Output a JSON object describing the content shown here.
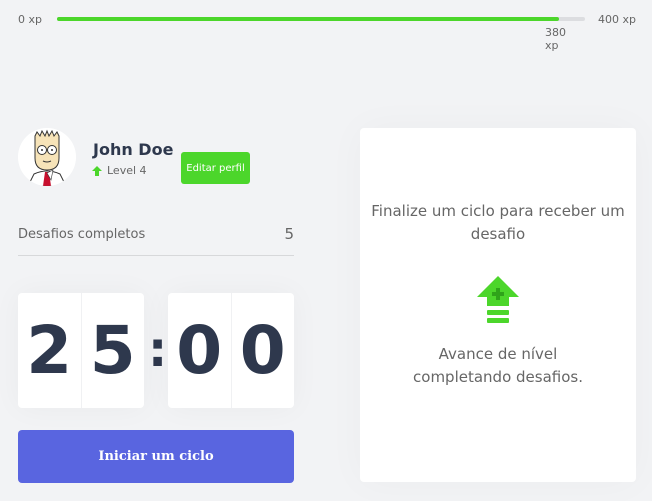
{
  "experience": {
    "min_label": "0 xp",
    "max_label": "400 xp",
    "current_label": "380 xp",
    "current_xp": 380,
    "max_xp": 400,
    "progress_fraction": 0.95,
    "bar_color": "#4cd62b"
  },
  "profile": {
    "name": "John Doe",
    "level_label": "Level 4",
    "level_icon": "level-up-arrow-icon",
    "edit_button_label": "Editar perfil",
    "avatar_icon": "avatar-cartoon"
  },
  "challenges": {
    "label": "Desafios completos",
    "count": "5"
  },
  "countdown": {
    "minutes": [
      "2",
      "5"
    ],
    "seconds": [
      "0",
      "0"
    ],
    "separator": ":"
  },
  "start_button": {
    "label": "Iniciar um ciclo",
    "color": "#5965e0"
  },
  "challenge_card": {
    "title": "Finalize um ciclo para receber um desafio",
    "icon": "level-up-icon",
    "text": "Avance de nível completando desafios."
  },
  "colors": {
    "background": "#f2f3f5",
    "text": "#666666",
    "title": "#2e384d",
    "green": "#4cd62b",
    "blue": "#5965e0"
  }
}
